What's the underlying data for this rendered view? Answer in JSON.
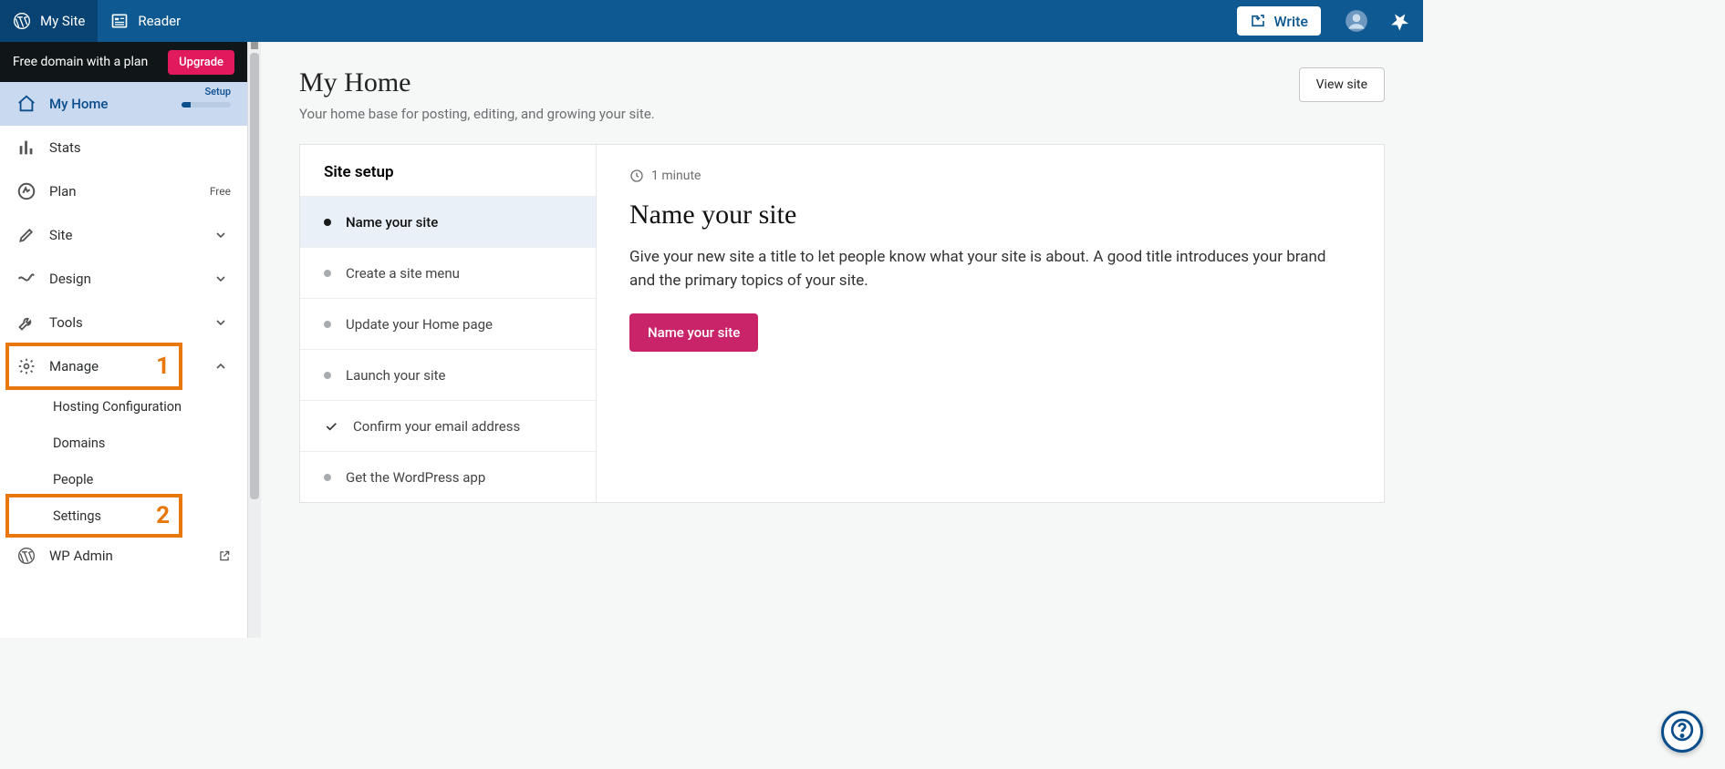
{
  "masterbar": {
    "my_site": "My Site",
    "reader": "Reader",
    "write": "Write"
  },
  "promo": {
    "text": "Free domain with a plan",
    "upgrade": "Upgrade"
  },
  "sidebar": {
    "items": [
      {
        "label": "My Home",
        "setup": "Setup"
      },
      {
        "label": "Stats"
      },
      {
        "label": "Plan",
        "meta": "Free"
      },
      {
        "label": "Site"
      },
      {
        "label": "Design"
      },
      {
        "label": "Tools"
      },
      {
        "label": "Manage"
      }
    ],
    "manage_children": [
      {
        "label": "Hosting Configuration"
      },
      {
        "label": "Domains"
      },
      {
        "label": "People"
      },
      {
        "label": "Settings"
      }
    ],
    "wp_admin": "WP Admin"
  },
  "annotations": {
    "num1": "1",
    "num2": "2"
  },
  "page": {
    "title": "My Home",
    "subtitle": "Your home base for posting, editing, and growing your site.",
    "view_site": "View site"
  },
  "setup": {
    "title": "Site setup",
    "items": [
      {
        "label": "Name your site"
      },
      {
        "label": "Create a site menu"
      },
      {
        "label": "Update your Home page"
      },
      {
        "label": "Launch your site"
      },
      {
        "label": "Confirm your email address"
      },
      {
        "label": "Get the WordPress app"
      }
    ]
  },
  "detail": {
    "minute": "1 minute",
    "title": "Name your site",
    "desc": "Give your new site a title to let people know what your site is about. A good title introduces your brand and the primary topics of your site.",
    "cta": "Name your site"
  }
}
